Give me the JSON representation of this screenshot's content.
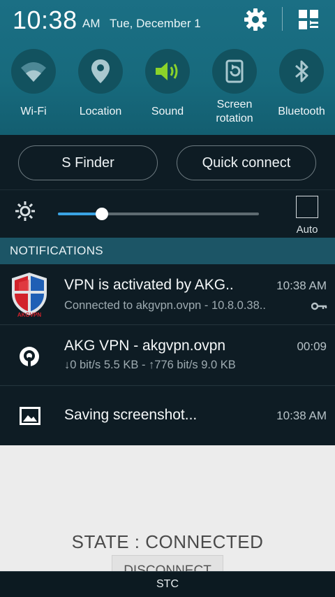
{
  "status": {
    "time": "10:38",
    "ampm": "AM",
    "date": "Tue, December 1"
  },
  "quick_settings": [
    {
      "label": "Wi-Fi",
      "icon": "wifi-icon"
    },
    {
      "label": "Location",
      "icon": "location-pin-icon"
    },
    {
      "label": "Sound",
      "icon": "speaker-icon",
      "active_color": "#8bd32a"
    },
    {
      "label": "Screen rotation",
      "icon": "rotation-icon"
    },
    {
      "label": "Bluetooth",
      "icon": "bluetooth-icon"
    }
  ],
  "buttons": {
    "sfinder": "S Finder",
    "quick_connect": "Quick connect"
  },
  "brightness": {
    "level": 0.22,
    "auto_label": "Auto",
    "auto_checked": false
  },
  "notifications_header": "NOTIFICATIONS",
  "notifications": [
    {
      "title": "VPN is activated by AKG..",
      "time": "10:38 AM",
      "subtitle": "Connected to akgvpn.ovpn - 10.8.0.38..",
      "icon": "akg-vpn-shield-icon",
      "trailing_icon": "key-icon"
    },
    {
      "title": "AKG VPN - akgvpn.ovpn",
      "time": "00:09",
      "subtitle": "↓0 bit/s 5.5 KB - ↑776 bit/s 9.0 KB",
      "icon": "openvpn-icon"
    },
    {
      "title": "Saving screenshot...",
      "time": "10:38 AM",
      "icon": "image-icon"
    }
  ],
  "app": {
    "state": "STATE : CONNECTED",
    "disconnect_label": "DISCONNECT"
  },
  "carrier": "STC",
  "colors": {
    "panel_teal": "#1b6f84",
    "header_teal": "#1c5566",
    "slider_blue": "#3aa3e3"
  }
}
